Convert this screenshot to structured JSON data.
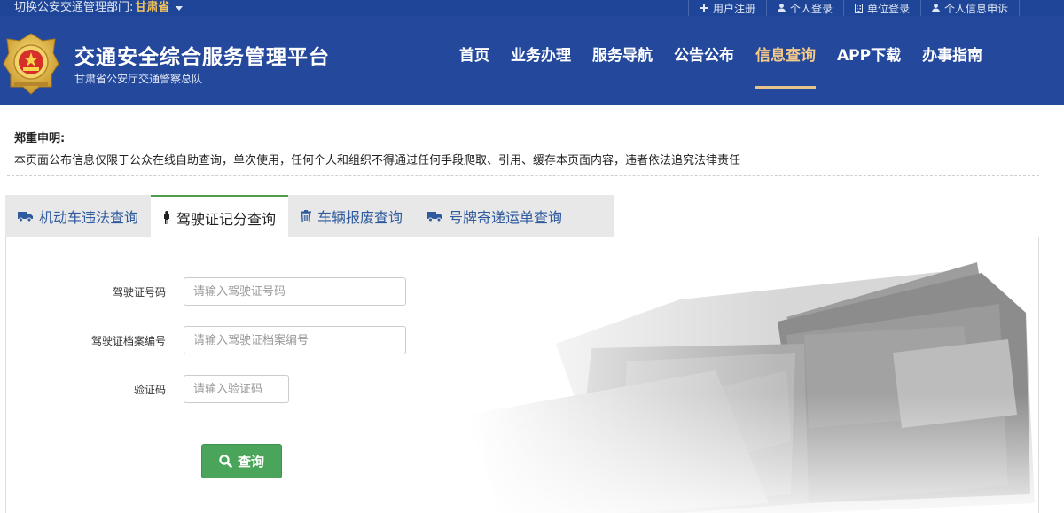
{
  "topbar": {
    "region_label": "切换公安交通管理部门:",
    "region_value": "甘肃省",
    "links": [
      {
        "icon": "plus-icon",
        "label": "用户注册"
      },
      {
        "icon": "user-icon",
        "label": "个人登录"
      },
      {
        "icon": "building-icon",
        "label": "单位登录"
      },
      {
        "icon": "user-icon",
        "label": "个人信息申诉"
      }
    ]
  },
  "header": {
    "title": "交通安全综合服务管理平台",
    "subtitle": "甘肃省公安厅交通警察总队",
    "nav": [
      {
        "label": "首页",
        "active": false
      },
      {
        "label": "业务办理",
        "active": false
      },
      {
        "label": "服务导航",
        "active": false
      },
      {
        "label": "公告公布",
        "active": false
      },
      {
        "label": "信息查询",
        "active": true
      },
      {
        "label": "APP下载",
        "active": false
      },
      {
        "label": "办事指南",
        "active": false
      }
    ]
  },
  "notice": {
    "title": "郑重申明:",
    "text": "本页面公布信息仅限于公众在线自助查询，单次使用，任何个人和组织不得通过任何手段爬取、引用、缓存本页面内容，违者依法追究法律责任"
  },
  "tabs": [
    {
      "icon": "truck-icon",
      "label": "机动车违法查询",
      "active": false
    },
    {
      "icon": "person-icon",
      "label": "驾驶证记分查询",
      "active": true
    },
    {
      "icon": "trash-icon",
      "label": "车辆报废查询",
      "active": false
    },
    {
      "icon": "truck-icon",
      "label": "号牌寄递运单查询",
      "active": false
    }
  ],
  "form": {
    "license_no": {
      "label": "驾驶证号码",
      "placeholder": "请输入驾驶证号码",
      "value": ""
    },
    "archive_no": {
      "label": "驾驶证档案编号",
      "placeholder": "请输入驾驶证档案编号",
      "value": ""
    },
    "captcha": {
      "label": "验证码",
      "placeholder": "请输入验证码",
      "value": ""
    },
    "submit_label": "查询"
  },
  "colors": {
    "header_bg": "#24499c",
    "topbar_bg": "#1e4597",
    "nav_active": "#f4c98a",
    "province_highlight": "#f3c45a",
    "tab_link": "#2f5a9d",
    "button_green": "#4aa55a"
  }
}
